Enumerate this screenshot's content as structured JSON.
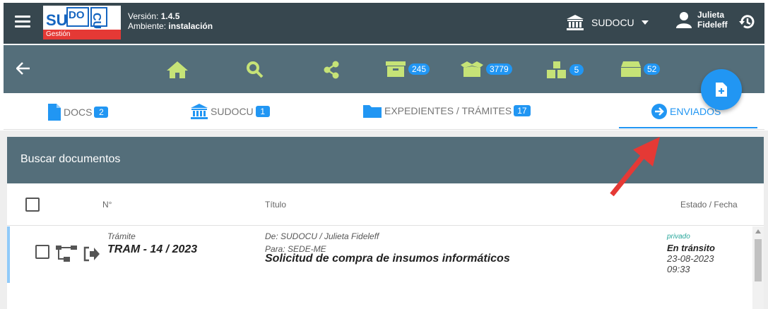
{
  "header": {
    "logo_main": "SUDOCU",
    "logo_sub": "Gestión",
    "version_label": "Versión:",
    "version_value": "1.4.5",
    "env_label": "Ambiente:",
    "env_value": "instalación",
    "organization": "SUDOCU",
    "user_first": "Julieta",
    "user_last": "Fideleff"
  },
  "toolbar": {
    "counts": [
      "245",
      "3779",
      "5",
      "52"
    ]
  },
  "tabs": [
    {
      "label": "DOCS",
      "count": "2"
    },
    {
      "label": "SUDOCU",
      "count": "1"
    },
    {
      "label": "EXPEDIENTES / TRÁMITES",
      "count": "17"
    },
    {
      "label": "ENVIADOS"
    }
  ],
  "search": {
    "title": "Buscar documentos"
  },
  "table": {
    "headers": [
      "N°",
      "Título",
      "Estado / Fecha"
    ],
    "rows": [
      {
        "type": "Trámite",
        "number": "TRAM - 14 / 2023",
        "from": "De: SUDOCU / Julieta Fideleff",
        "to": "Para: SEDE-ME",
        "title": "Solicitud de compra de insumos informáticos",
        "privacy": "privado",
        "status": "En tránsito",
        "date": "23-08-2023",
        "time": "09:33"
      }
    ]
  },
  "colors": {
    "topbar": "#37474f",
    "navbar": "#546e7a",
    "accent": "#2196f3",
    "icons": "#c6e377",
    "alert_arrow": "#e53935"
  }
}
